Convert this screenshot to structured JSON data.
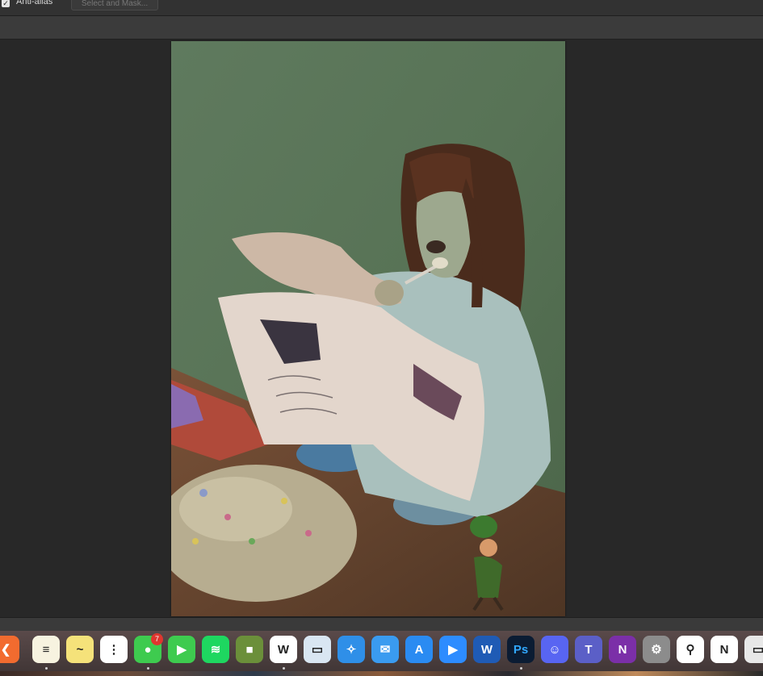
{
  "options_bar": {
    "anti_alias_label": "Anti-alias",
    "anti_alias_checked": true,
    "select_and_mask_label": "Select and Mask..."
  },
  "dock": {
    "apps": [
      {
        "name": "Affinity-like app",
        "icon": "chevron-left-icon",
        "running": false,
        "bg": "#f26b2f"
      },
      {
        "name": "Notes",
        "icon": "notes-icon",
        "running": true,
        "bg": "#f7f3e0"
      },
      {
        "name": "Stickies",
        "icon": "stickies-icon",
        "running": false,
        "bg": "#f5e27a"
      },
      {
        "name": "Reminders",
        "icon": "reminders-icon",
        "running": false,
        "bg": "#ffffff"
      },
      {
        "name": "Messages",
        "icon": "messages-icon",
        "running": true,
        "bg": "#3ecb4f",
        "badge": "7"
      },
      {
        "name": "FaceTime",
        "icon": "facetime-icon",
        "running": false,
        "bg": "#3ecb4f"
      },
      {
        "name": "Spotify",
        "icon": "spotify-icon",
        "running": false,
        "bg": "#1ed760"
      },
      {
        "name": "Minecraft",
        "icon": "grass-block-icon",
        "running": false,
        "bg": "#6b8f3a"
      },
      {
        "name": "Webex-like app",
        "icon": "w-icon",
        "running": true,
        "bg": "#ffffff"
      },
      {
        "name": "Preview",
        "icon": "preview-icon",
        "running": false,
        "bg": "#d9e6f2"
      },
      {
        "name": "Safari",
        "icon": "compass-icon",
        "running": false,
        "bg": "#2f8fe8"
      },
      {
        "name": "Mail",
        "icon": "mail-icon",
        "running": false,
        "bg": "#3a9bf0"
      },
      {
        "name": "App Store",
        "icon": "app-store-icon",
        "running": false,
        "bg": "#2a8bf2"
      },
      {
        "name": "Zoom",
        "icon": "video-camera-icon",
        "running": false,
        "bg": "#2d8cff"
      },
      {
        "name": "Word",
        "icon": "W",
        "running": false,
        "bg": "#1f5bb5"
      },
      {
        "name": "Photoshop",
        "icon": "Ps",
        "running": true,
        "bg": "#0b1c33"
      },
      {
        "name": "Discord",
        "icon": "discord-icon",
        "running": false,
        "bg": "#5865f2"
      },
      {
        "name": "Teams",
        "icon": "teams-icon",
        "running": false,
        "bg": "#5b5fc7"
      },
      {
        "name": "OneNote",
        "icon": "N",
        "running": false,
        "bg": "#7b2fa8"
      },
      {
        "name": "System Settings",
        "icon": "gear-icon",
        "running": false,
        "bg": "#8c8c8c"
      },
      {
        "name": "Pinterest-like app",
        "icon": "magnifier-icon",
        "running": false,
        "bg": "#ffffff"
      },
      {
        "name": "Notion",
        "icon": "N",
        "running": false,
        "bg": "#ffffff"
      },
      {
        "name": "Misc app",
        "icon": "window-icon",
        "running": false,
        "bg": "#e8e8e8"
      }
    ]
  }
}
